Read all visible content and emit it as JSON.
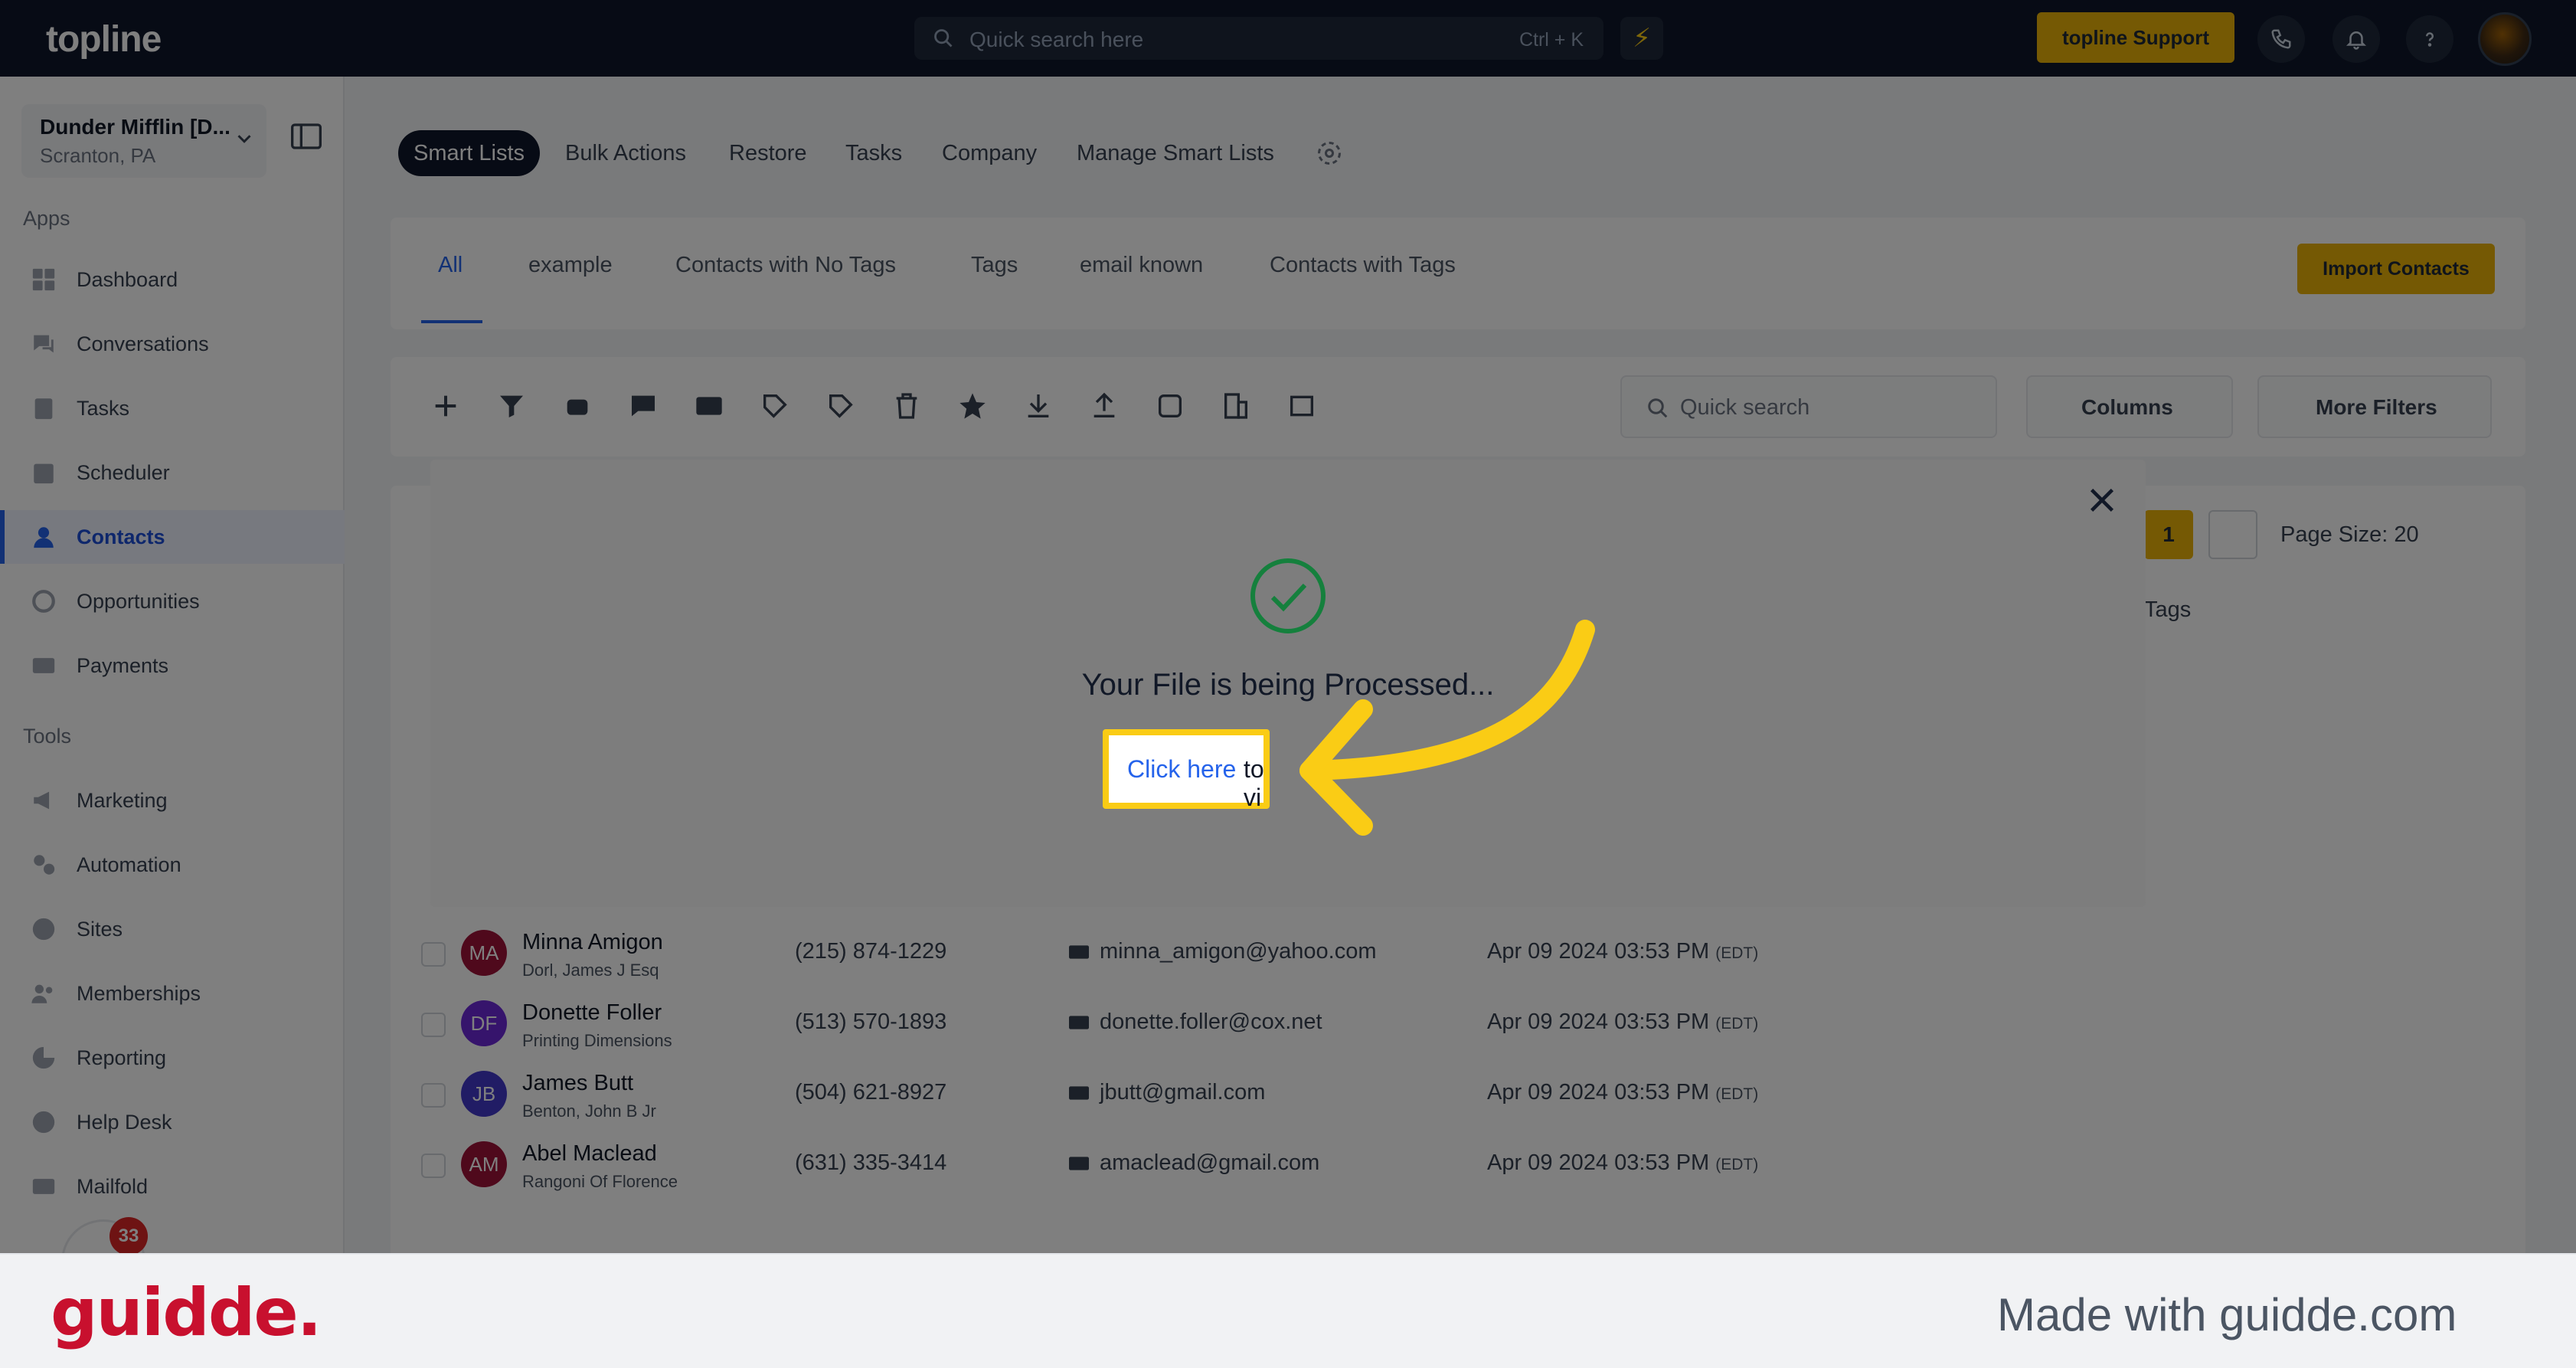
{
  "app": {
    "logo": "topline",
    "search_placeholder": "Quick search here",
    "search_shortcut": "Ctrl + K",
    "support_label": "topline Support"
  },
  "sidebar": {
    "account_name": "Dunder Mifflin [D...",
    "account_location": "Scranton, PA",
    "apps_label": "Apps",
    "tools_label": "Tools",
    "apps": [
      {
        "label": "Dashboard",
        "icon": "dashboard-icon"
      },
      {
        "label": "Conversations",
        "icon": "chat-icon"
      },
      {
        "label": "Tasks",
        "icon": "clipboard-icon"
      },
      {
        "label": "Scheduler",
        "icon": "calendar-icon"
      },
      {
        "label": "Contacts",
        "icon": "user-icon",
        "active": true
      },
      {
        "label": "Opportunities",
        "icon": "target-icon"
      },
      {
        "label": "Payments",
        "icon": "card-icon"
      }
    ],
    "tools": [
      {
        "label": "Marketing",
        "icon": "megaphone-icon"
      },
      {
        "label": "Automation",
        "icon": "gears-icon"
      },
      {
        "label": "Sites",
        "icon": "globe-icon"
      },
      {
        "label": "Memberships",
        "icon": "users-icon"
      },
      {
        "label": "Reporting",
        "icon": "chart-icon"
      },
      {
        "label": "Help Desk",
        "icon": "help-icon"
      },
      {
        "label": "Mailfold",
        "icon": "mail-icon"
      }
    ],
    "notification_count": "33"
  },
  "tabs": [
    "Smart Lists",
    "Bulk Actions",
    "Restore",
    "Tasks",
    "Company",
    "Manage Smart Lists"
  ],
  "subtabs": [
    "All",
    "example",
    "Contacts with No Tags",
    "Tags",
    "email known",
    "Contacts with Tags"
  ],
  "import_label": "Import Contacts",
  "list": {
    "quick_search_placeholder": "Quick search",
    "columns_label": "Columns",
    "more_filters_label": "More Filters",
    "current_page": "1",
    "page_size_label": "Page Size: 20",
    "tags_header": "Tags"
  },
  "contacts": [
    {
      "initials": "MA",
      "name": "Minna Amigon",
      "company": "Dorl, James J Esq",
      "phone": "(215) 874-1229",
      "email": "minna_amigon@yahoo.com",
      "date": "Apr 09 2024 03:53 PM",
      "tz": "(EDT)",
      "color": "#9f1239"
    },
    {
      "initials": "DF",
      "name": "Donette Foller",
      "company": "Printing Dimensions",
      "phone": "(513) 570-1893",
      "email": "donette.foller@cox.net",
      "date": "Apr 09 2024 03:53 PM",
      "tz": "(EDT)",
      "color": "#6d28d9"
    },
    {
      "initials": "JB",
      "name": "James Butt",
      "company": "Benton, John B Jr",
      "phone": "(504) 621-8927",
      "email": "jbutt@gmail.com",
      "date": "Apr 09 2024 03:53 PM",
      "tz": "(EDT)",
      "color": "#4338ca"
    },
    {
      "initials": "AM",
      "name": "Abel Maclead",
      "company": "Rangoni Of Florence",
      "phone": "(631) 335-3414",
      "email": "amaclead@gmail.com",
      "date": "Apr 09 2024 03:53 PM",
      "tz": "(EDT)",
      "color": "#9f1239"
    }
  ],
  "modal": {
    "message": "Your File is being Processed...",
    "link_label": "Click here",
    "after_link_visible": "to vi"
  },
  "footer": {
    "brand": "guidde.",
    "made_with": "Made with guidde.com"
  },
  "colors": {
    "accent": "#eab308",
    "nav": "#0f172a",
    "link": "#2563eb",
    "highlight": "#facc15",
    "brand": "#c8102e"
  }
}
